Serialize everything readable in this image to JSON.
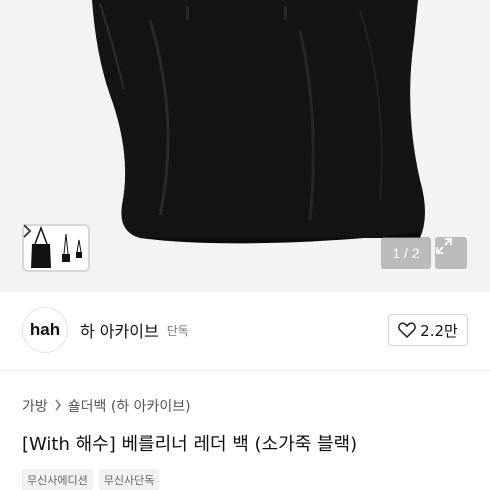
{
  "gallery": {
    "pager_text": "1 / 2",
    "icons": {
      "next": "chevron-right-icon",
      "expand": "expand-icon"
    }
  },
  "brand": {
    "logo_text": "hah",
    "name": "하 아카이브",
    "badge": "단독",
    "likes": "2.2만",
    "like_icon": "heart-icon"
  },
  "breadcrumb": [
    "가방",
    "숄더백 (하 아카이브)"
  ],
  "product": {
    "title": "[With 해수] 베를리너 레더 백 (소가죽 블랙)",
    "tags": [
      "무신사에디션",
      "무신사단독"
    ]
  },
  "colors": {
    "accent": "#111111",
    "background": "#f3f3f3"
  }
}
